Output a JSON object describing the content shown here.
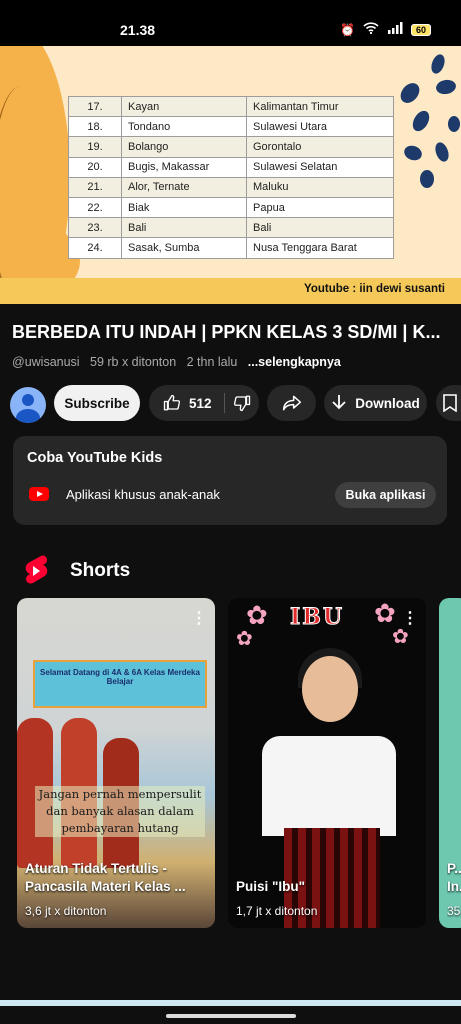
{
  "status": {
    "time": "21.38",
    "battery": "60"
  },
  "video_frame": {
    "rows": [
      {
        "no": "17.",
        "tribe": "Kayan",
        "province": "Kalimantan Timur"
      },
      {
        "no": "18.",
        "tribe": "Tondano",
        "province": "Sulawesi Utara"
      },
      {
        "no": "19.",
        "tribe": "Bolango",
        "province": "Gorontalo"
      },
      {
        "no": "20.",
        "tribe": "Bugis, Makassar",
        "province": "Sulawesi Selatan"
      },
      {
        "no": "21.",
        "tribe": "Alor, Ternate",
        "province": "Maluku"
      },
      {
        "no": "22.",
        "tribe": "Biak",
        "province": "Papua"
      },
      {
        "no": "23.",
        "tribe": "Bali",
        "province": "Bali"
      },
      {
        "no": "24.",
        "tribe": "Sasak, Sumba",
        "province": "Nusa Tenggara Barat"
      }
    ],
    "credit": "Youtube  : iin dewi susanti"
  },
  "video": {
    "title": "BERBEDA ITU INDAH | PPKN KELAS 3 SD/MI | K...",
    "channel": "@uwisanusi",
    "views": "59 rb x ditonton",
    "age": "2 thn lalu",
    "more": "...selengkapnya"
  },
  "actions": {
    "subscribe": "Subscribe",
    "likes": "512",
    "download": "Download"
  },
  "kids_promo": {
    "heading": "Coba YouTube Kids",
    "description": "Aplikasi khusus anak-anak",
    "button": "Buka aplikasi"
  },
  "shorts": {
    "heading": "Shorts",
    "items": [
      {
        "title": "Aturan Tidak Tertulis - Pancasila Materi Kelas ...",
        "views": "3,6 jt x ditonton",
        "banner": "Selamat Datang di 4A & 6A Kelas Merdeka Belajar",
        "caption": "Jangan pernah mempersulit dan banyak alasan dalam pembayaran hutang"
      },
      {
        "title": "Puisi \"Ibu\"",
        "views": "1,7 jt x ditonton",
        "overlay": "IBU"
      },
      {
        "title": "P... In...",
        "views": "35..."
      }
    ]
  },
  "colors": {
    "background": "#0f0f0f",
    "chip": "#272727",
    "brand_red": "#ff0000"
  }
}
